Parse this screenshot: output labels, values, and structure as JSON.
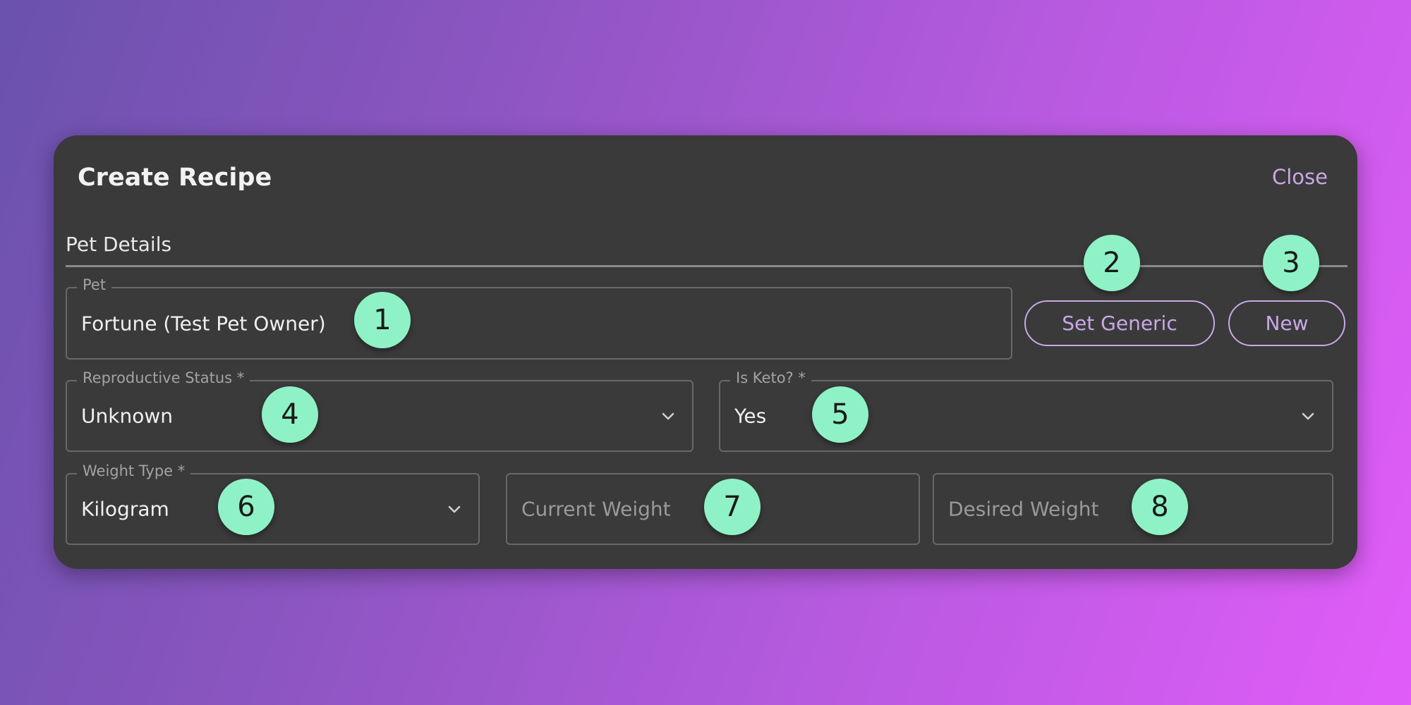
{
  "dialog": {
    "title": "Create Recipe",
    "close_label": "Close",
    "section_title": "Pet Details"
  },
  "pet": {
    "label": "Pet",
    "value": "Fortune (Test Pet Owner)"
  },
  "actions": {
    "set_generic_label": "Set Generic",
    "new_label": "New"
  },
  "reproductive_status": {
    "label": "Reproductive Status *",
    "value": "Unknown"
  },
  "is_keto": {
    "label": "Is Keto? *",
    "value": "Yes"
  },
  "weight_type": {
    "label": "Weight Type *",
    "value": "Kilogram"
  },
  "current_weight": {
    "placeholder": "Current Weight"
  },
  "desired_weight": {
    "placeholder": "Desired Weight"
  },
  "badges": [
    "1",
    "2",
    "3",
    "4",
    "5",
    "6",
    "7",
    "8"
  ],
  "colors": {
    "accent": "#c8a8e6",
    "badge": "#8ff2c6",
    "dialog_bg": "#3a3a3a"
  }
}
